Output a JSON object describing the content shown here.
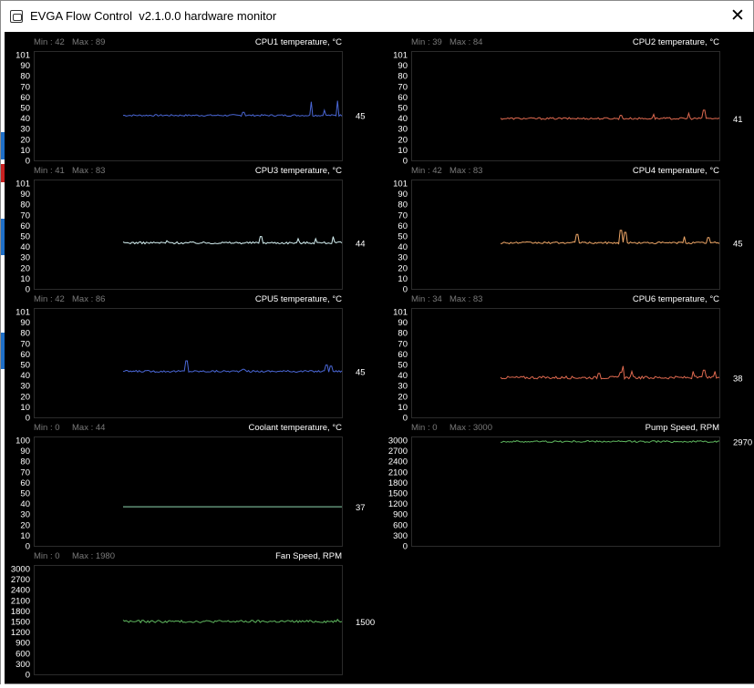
{
  "window": {
    "title": "EVGA Flow Control  v2.1.0.0 hardware monitor",
    "close_label": "✕",
    "icon": "app-icon"
  },
  "colors": {
    "background": "#000000",
    "plot_border": "#2b2b2b",
    "grid": "#1a1a1a",
    "axis_text": "#ffffff",
    "minmax_text": "#7a7a7a"
  },
  "graphs": [
    {
      "key": "cpu1",
      "title": "CPU1 temperature, °C",
      "min_label": "Min : 42",
      "max_label": "Max : 89",
      "current": "45",
      "color": "#4a67d6",
      "ticks": [
        "101",
        "90",
        "80",
        "70",
        "60",
        "50",
        "40",
        "30",
        "20",
        "10",
        "0"
      ],
      "y_max": 101,
      "base": 43,
      "noise": 0.8,
      "spikes": [
        [
          0.55,
          46
        ],
        [
          0.86,
          56
        ],
        [
          0.98,
          57
        ],
        [
          0.92,
          48
        ]
      ]
    },
    {
      "key": "cpu2",
      "title": "CPU2 temperature, °C",
      "min_label": "Min : 39",
      "max_label": "Max : 84",
      "current": "41",
      "color": "#e06a50",
      "ticks": [
        "101",
        "90",
        "80",
        "70",
        "60",
        "50",
        "40",
        "30",
        "20",
        "10",
        "0"
      ],
      "y_max": 101,
      "base": 40,
      "noise": 0.9,
      "spikes": [
        [
          0.55,
          43
        ],
        [
          0.86,
          45
        ],
        [
          0.93,
          48
        ],
        [
          0.7,
          44
        ]
      ]
    },
    {
      "key": "cpu3",
      "title": "CPU3 temperature, °C",
      "min_label": "Min : 41",
      "max_label": "Max : 83",
      "current": "44",
      "color": "#d8f4f6",
      "ticks": [
        "101",
        "90",
        "80",
        "70",
        "60",
        "50",
        "40",
        "30",
        "20",
        "10",
        "0"
      ],
      "y_max": 101,
      "base": 44,
      "noise": 1.0,
      "spikes": [
        [
          0.63,
          50
        ],
        [
          0.8,
          48
        ],
        [
          0.88,
          48
        ],
        [
          0.96,
          50
        ],
        [
          0.2,
          46
        ]
      ]
    },
    {
      "key": "cpu4",
      "title": "CPU4 temperature, °C",
      "min_label": "Min : 42",
      "max_label": "Max : 83",
      "current": "45",
      "color": "#f0a868",
      "ticks": [
        "101",
        "90",
        "80",
        "70",
        "60",
        "50",
        "40",
        "30",
        "20",
        "10",
        "0"
      ],
      "y_max": 101,
      "base": 44,
      "noise": 0.9,
      "spikes": [
        [
          0.35,
          52
        ],
        [
          0.55,
          56
        ],
        [
          0.57,
          54
        ],
        [
          0.84,
          50
        ],
        [
          0.95,
          49
        ]
      ]
    },
    {
      "key": "cpu5",
      "title": "CPU5 temperature, °C",
      "min_label": "Min : 42",
      "max_label": "Max : 86",
      "current": "45",
      "color": "#4a67d6",
      "ticks": [
        "101",
        "90",
        "80",
        "70",
        "60",
        "50",
        "40",
        "30",
        "20",
        "10",
        "0"
      ],
      "y_max": 101,
      "base": 44,
      "noise": 0.9,
      "spikes": [
        [
          0.29,
          54
        ],
        [
          0.93,
          50
        ],
        [
          0.95,
          49
        ],
        [
          0.55,
          46
        ]
      ]
    },
    {
      "key": "cpu6",
      "title": "CPU6 temperature, °C",
      "min_label": "Min : 34",
      "max_label": "Max : 83",
      "current": "38",
      "color": "#e06a50",
      "ticks": [
        "101",
        "90",
        "80",
        "70",
        "60",
        "50",
        "40",
        "30",
        "20",
        "10",
        "0"
      ],
      "y_max": 101,
      "base": 38,
      "noise": 1.3,
      "spikes": [
        [
          0.55,
          43
        ],
        [
          0.6,
          44
        ],
        [
          0.56,
          49
        ],
        [
          0.88,
          44
        ],
        [
          0.93,
          45
        ],
        [
          0.98,
          44
        ],
        [
          0.45,
          42
        ]
      ]
    },
    {
      "key": "coolant",
      "title": "Coolant temperature, °C",
      "min_label": "Min : 0",
      "max_label": "Max : 44",
      "current": "37",
      "color": "#8fd8b0",
      "ticks": [
        "100",
        "90",
        "80",
        "70",
        "60",
        "50",
        "40",
        "30",
        "20",
        "10",
        "0"
      ],
      "y_max": 100,
      "base": 37,
      "noise": 0,
      "spikes": []
    },
    {
      "key": "pump",
      "title": "Pump Speed, RPM",
      "min_label": "Min : 0",
      "max_label": "Max : 3000",
      "current": "2970",
      "color": "#5fb85f",
      "ticks": [
        "3000",
        "2700",
        "2400",
        "2100",
        "1800",
        "1500",
        "1200",
        "900",
        "600",
        "300",
        "0"
      ],
      "y_max": 3000,
      "base": 2960,
      "noise": 25,
      "spikes": [
        [
          0.4,
          2990
        ],
        [
          0.7,
          2985
        ]
      ]
    },
    {
      "key": "fan",
      "title": "Fan Speed, RPM",
      "min_label": "Min : 0",
      "max_label": "Max : 1980",
      "current": "1500",
      "color": "#5fb85f",
      "ticks": [
        "3000",
        "2700",
        "2400",
        "2100",
        "1800",
        "1500",
        "1200",
        "900",
        "600",
        "300",
        "0"
      ],
      "y_max": 3000,
      "base": 1500,
      "noise": 35,
      "spikes": [
        [
          0.0,
          1540
        ],
        [
          0.98,
          1560
        ]
      ]
    }
  ]
}
